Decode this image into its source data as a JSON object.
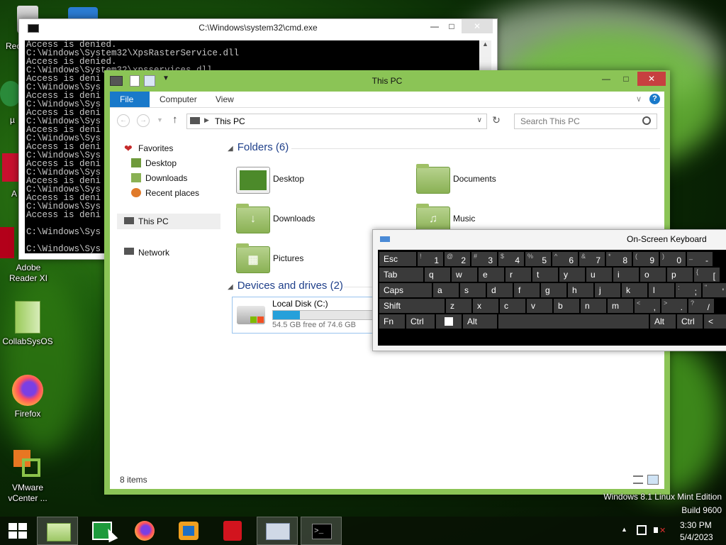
{
  "desktop": {
    "icons": [
      {
        "name": "recycle-bin",
        "label": "Rec"
      },
      {
        "name": "mu-app",
        "label": "µ"
      },
      {
        "name": "acrobat-app",
        "label": "A"
      },
      {
        "name": "adobe-reader",
        "label": "Adobe Reader XI"
      },
      {
        "name": "collabsysos",
        "label": "CollabSysOS"
      },
      {
        "name": "firefox",
        "label": "Firefox"
      },
      {
        "name": "vmware-vcenter",
        "label": "VMware vCenter ..."
      }
    ],
    "watermark_line1": "Windows 8.1 Linux Mint Edition",
    "watermark_line2": "Build 9600"
  },
  "cmd": {
    "title": "C:\\Windows\\system32\\cmd.exe",
    "lines": [
      "Access is denied.",
      "C:\\Windows\\System32\\XpsRasterService.dll",
      "Access is denied.",
      "C:\\Windows\\System32\\xpsservices.dll",
      "Access is deni",
      "C:\\Windows\\Sys",
      "Access is deni",
      "C:\\Windows\\Sys",
      "Access is deni",
      "C:\\Windows\\Sys",
      "Access is deni",
      "C:\\Windows\\Sys",
      "Access is deni",
      "C:\\Windows\\Sys",
      "Access is deni",
      "C:\\Windows\\Sys",
      "Access is deni",
      "C:\\Windows\\Sys",
      "Access is deni",
      "C:\\Windows\\Sys",
      "Access is deni",
      "",
      "C:\\Windows\\Sys",
      "",
      "C:\\Windows\\Sys"
    ]
  },
  "explorer": {
    "title": "This PC",
    "ribbon_tabs": [
      "File",
      "Computer",
      "View"
    ],
    "address": "This PC",
    "search_placeholder": "Search This PC",
    "nav": {
      "favorites": "Favorites",
      "desktop": "Desktop",
      "downloads": "Downloads",
      "recent": "Recent places",
      "thispc": "This PC",
      "network": "Network"
    },
    "folders_header": "Folders (6)",
    "folders": [
      "Desktop",
      "Documents",
      "Downloads",
      "Music",
      "Pictures"
    ],
    "devices_header": "Devices and drives (2)",
    "drive": {
      "name": "Local Disk (C:)",
      "free_text": "54.5 GB free of 74.6 GB",
      "used_fraction": 0.27
    },
    "status": "8 items",
    "accent": "#8bc456"
  },
  "osk": {
    "title": "On-Screen Keyboard",
    "rows": [
      [
        [
          "Esc",
          ""
        ],
        [
          "1",
          "!"
        ],
        [
          "2",
          "@"
        ],
        [
          "3",
          "#"
        ],
        [
          "4",
          "$"
        ],
        [
          "5",
          "%"
        ],
        [
          "6",
          "^"
        ],
        [
          "7",
          "&"
        ],
        [
          "8",
          "*"
        ],
        [
          "9",
          "("
        ],
        [
          "0",
          ")"
        ],
        [
          "-",
          "_"
        ]
      ],
      [
        [
          "Tab",
          ""
        ],
        [
          "q",
          ""
        ],
        [
          "w",
          ""
        ],
        [
          "e",
          ""
        ],
        [
          "r",
          ""
        ],
        [
          "t",
          ""
        ],
        [
          "y",
          ""
        ],
        [
          "u",
          ""
        ],
        [
          "i",
          ""
        ],
        [
          "o",
          ""
        ],
        [
          "p",
          ""
        ],
        [
          "[",
          "{"
        ]
      ],
      [
        [
          "Caps",
          ""
        ],
        [
          "a",
          ""
        ],
        [
          "s",
          ""
        ],
        [
          "d",
          ""
        ],
        [
          "f",
          ""
        ],
        [
          "g",
          ""
        ],
        [
          "h",
          ""
        ],
        [
          "j",
          ""
        ],
        [
          "k",
          ""
        ],
        [
          "l",
          ""
        ],
        [
          ";",
          ":"
        ],
        [
          "'",
          "\""
        ]
      ],
      [
        [
          "Shift",
          ""
        ],
        [
          "z",
          ""
        ],
        [
          "x",
          ""
        ],
        [
          "c",
          ""
        ],
        [
          "v",
          ""
        ],
        [
          "b",
          ""
        ],
        [
          "n",
          ""
        ],
        [
          "m",
          ""
        ],
        [
          ",",
          "<"
        ],
        [
          ".",
          ">"
        ],
        [
          "/",
          "?"
        ]
      ],
      [
        [
          "Fn",
          ""
        ],
        [
          "Ctrl",
          ""
        ],
        [
          "",
          ""
        ],
        [
          "Alt",
          ""
        ],
        [
          "",
          ""
        ],
        [
          "Alt",
          ""
        ],
        [
          "Ctrl",
          ""
        ],
        [
          "<",
          ""
        ]
      ]
    ]
  },
  "taskbar": {
    "time": "3:30 PM",
    "date": "5/4/2023"
  }
}
